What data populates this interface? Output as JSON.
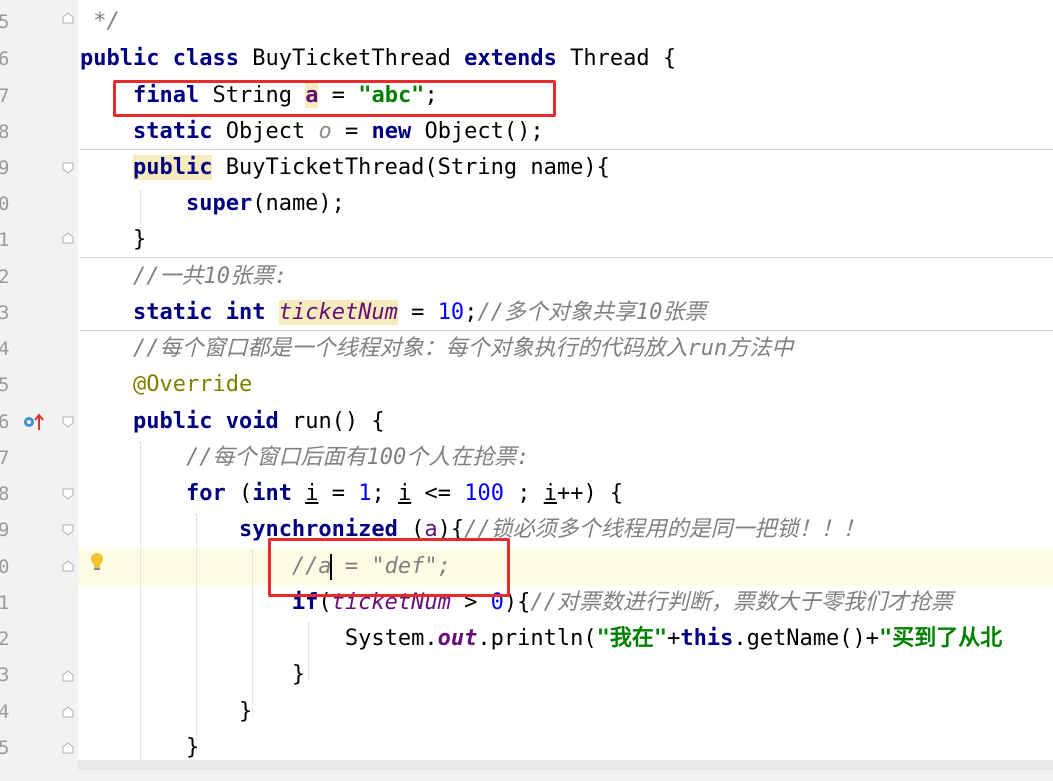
{
  "gutter": {
    "line_numbers": [
      "5",
      "6",
      "7",
      "8",
      "9",
      "0",
      "1",
      "2",
      "3",
      "4",
      "5",
      "6",
      "7",
      "8",
      "9",
      "0",
      "1",
      "2",
      "3",
      "4",
      "5"
    ]
  },
  "code": {
    "l1": [
      "*/"
    ],
    "l2": [
      "public",
      "class",
      "BuyTicketThread",
      "extends",
      "Thread {"
    ],
    "l3": [
      "final",
      "String",
      "a",
      " = ",
      "\"abc\"",
      ";"
    ],
    "l4": [
      "static",
      "Object",
      "o",
      " = ",
      "new",
      " Object();"
    ],
    "l5": [
      "public",
      " BuyTicketThread(String name){"
    ],
    "l6": [
      "super",
      "(name);"
    ],
    "l7": [
      "}"
    ],
    "l8": [
      "//一共10张票:"
    ],
    "l9": [
      "static",
      "int",
      "ticketNum",
      " = ",
      "10",
      ";",
      "//多个对象共享10张票"
    ],
    "l10": [
      "//每个窗口都是一个线程对象：每个对象执行的代码放入run方法中"
    ],
    "l11": [
      "@Override"
    ],
    "l12": [
      "public",
      "void",
      " run() {"
    ],
    "l13": [
      "//每个窗口后面有100个人在抢票:"
    ],
    "l14": [
      "for",
      " (",
      "int",
      "i",
      " = ",
      "1",
      "; ",
      "i",
      " <= ",
      "100",
      " ; ",
      "i",
      "++) {"
    ],
    "l15": [
      "synchronized",
      " (",
      "a",
      "){",
      "//锁必须多个线程用的是同一把锁！！！"
    ],
    "l16": [
      "//",
      "a = \"def\";"
    ],
    "l17": [
      "if",
      "(",
      "ticketNum",
      " > ",
      "0",
      "){",
      "//对票数进行判断，票数大于零我们才抢票"
    ],
    "l18": [
      "System.",
      "out",
      ".println(",
      "\"我在\"",
      "+",
      "this",
      ".getName()+",
      "\"买到了从北"
    ],
    "l19": [
      "}"
    ],
    "l20": [
      "}"
    ],
    "l21": [
      "}"
    ]
  },
  "colors": {
    "keyword": "#000080",
    "string": "#008000",
    "number": "#0000ff",
    "comment": "#808080",
    "field": "#660e7a",
    "annotation": "#808000",
    "highlight_box": "#e82a2a",
    "current_line": "#fdfbe3"
  },
  "icons": {
    "override_marker": "override-arrow-icon",
    "intention_bulb": "lightbulb-icon",
    "fold": "fold-marker-icon"
  }
}
